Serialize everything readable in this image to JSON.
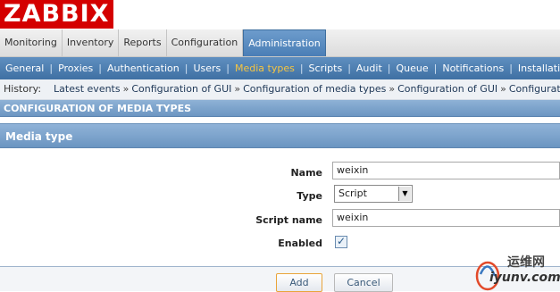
{
  "header": {
    "logo_text": "ZABBIX"
  },
  "main_menu": [
    {
      "label": "Monitoring",
      "active": false
    },
    {
      "label": "Inventory",
      "active": false
    },
    {
      "label": "Reports",
      "active": false
    },
    {
      "label": "Configuration",
      "active": false
    },
    {
      "label": "Administration",
      "active": true
    }
  ],
  "sub_menu": [
    {
      "label": "General",
      "active": false
    },
    {
      "label": "Proxies",
      "active": false
    },
    {
      "label": "Authentication",
      "active": false
    },
    {
      "label": "Users",
      "active": false
    },
    {
      "label": "Media types",
      "active": true
    },
    {
      "label": "Scripts",
      "active": false
    },
    {
      "label": "Audit",
      "active": false
    },
    {
      "label": "Queue",
      "active": false
    },
    {
      "label": "Notifications",
      "active": false
    },
    {
      "label": "Installati",
      "active": false
    }
  ],
  "history": {
    "label": "History:",
    "items": [
      "Latest events",
      "Configuration of GUI",
      "Configuration of media types",
      "Configuration of GUI",
      "Configuration of"
    ]
  },
  "page_title": "CONFIGURATION OF MEDIA TYPES",
  "form": {
    "header": "Media type",
    "name_label": "Name",
    "name_value": "weixin",
    "type_label": "Type",
    "type_value": "Script",
    "script_name_label": "Script name",
    "script_name_value": "weixin",
    "enabled_label": "Enabled",
    "enabled": true
  },
  "buttons": {
    "add": "Add",
    "cancel": "Cancel"
  },
  "watermark": {
    "line1": "运维网",
    "line2": "iyunv.com"
  },
  "colors": {
    "brand": "#d40000",
    "accent": "#4a7eb6",
    "active_submenu": "#f5c542"
  }
}
